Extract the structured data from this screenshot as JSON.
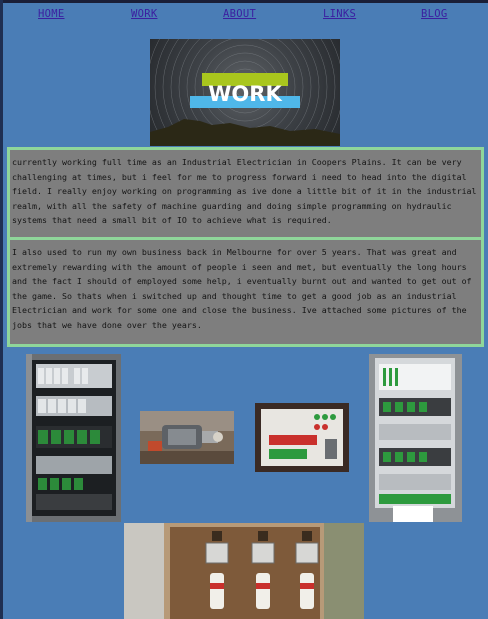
{
  "nav": {
    "items": [
      {
        "label": "HOME"
      },
      {
        "label": "WORK"
      },
      {
        "label": "ABOUT"
      },
      {
        "label": "LINKS"
      },
      {
        "label": "BLOG"
      }
    ]
  },
  "hero": {
    "banner_text": "WORK",
    "colors": {
      "green_bar": "#a9c61d",
      "blue_bar": "#4fb7e9",
      "text": "#ffffff"
    }
  },
  "content": {
    "paragraph_1": "currently working full time as an Industrial Electrician in Coopers Plains. It can be very challenging at times, but i feel for me to progress forward i need to head into the digital field. I really enjoy working on programming as ive done a little bit of it in the industrial realm, with all the safety of machine guarding and doing simple programming on hydraulic systems that need a small bit of IO to achieve what is required.",
    "paragraph_2": "I also used to run my own business back in Melbourne for over 5 years. That was great and extremely rewarding with the amount of people i seen and met, but eventually the long hours and the fact I should of employed some help, i eventually burnt out and wanted to get out of the game. So thats when i switched up and thought time to get a good job as an industrial Electrician and work for some one and close the business. Ive attached some pictures of the jobs that we have done over the years."
  },
  "gallery": {
    "photos": [
      {
        "subject": "plc-control-cabinet"
      },
      {
        "subject": "motor-assembly"
      },
      {
        "subject": "control-panel-indicators"
      },
      {
        "subject": "io-terminal-cabinet"
      },
      {
        "subject": "fuse-switchboard"
      }
    ]
  },
  "colors": {
    "page_background": "#4a7db6",
    "panel_background": "#7e7e7e",
    "panel_border": "#8fd69a",
    "nav_link": "#3b1fa0"
  }
}
